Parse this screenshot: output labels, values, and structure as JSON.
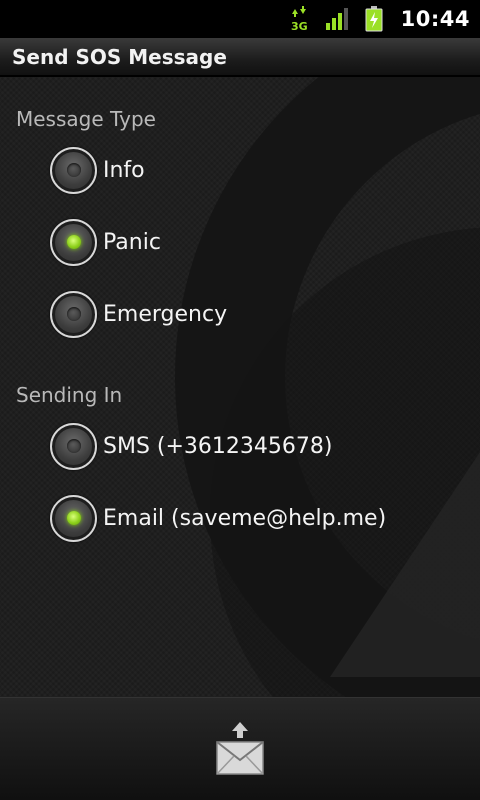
{
  "status_bar": {
    "network_label": "3G",
    "time": "10:44"
  },
  "title": "Send SOS Message",
  "message_type": {
    "label": "Message Type",
    "selected": "Panic",
    "options": [
      {
        "label": "Info",
        "checked": false
      },
      {
        "label": "Panic",
        "checked": true
      },
      {
        "label": "Emergency",
        "checked": false
      }
    ]
  },
  "sending_in": {
    "label": "Sending In",
    "options": [
      {
        "label": "SMS (+3612345678)",
        "checked": false
      },
      {
        "label": "Email (saveme@help.me)",
        "checked": true
      }
    ]
  },
  "bottom": {
    "send_icon": "send-mail-icon"
  },
  "colors": {
    "accent_green": "#8ed11c",
    "background": "#1b1b1b"
  }
}
